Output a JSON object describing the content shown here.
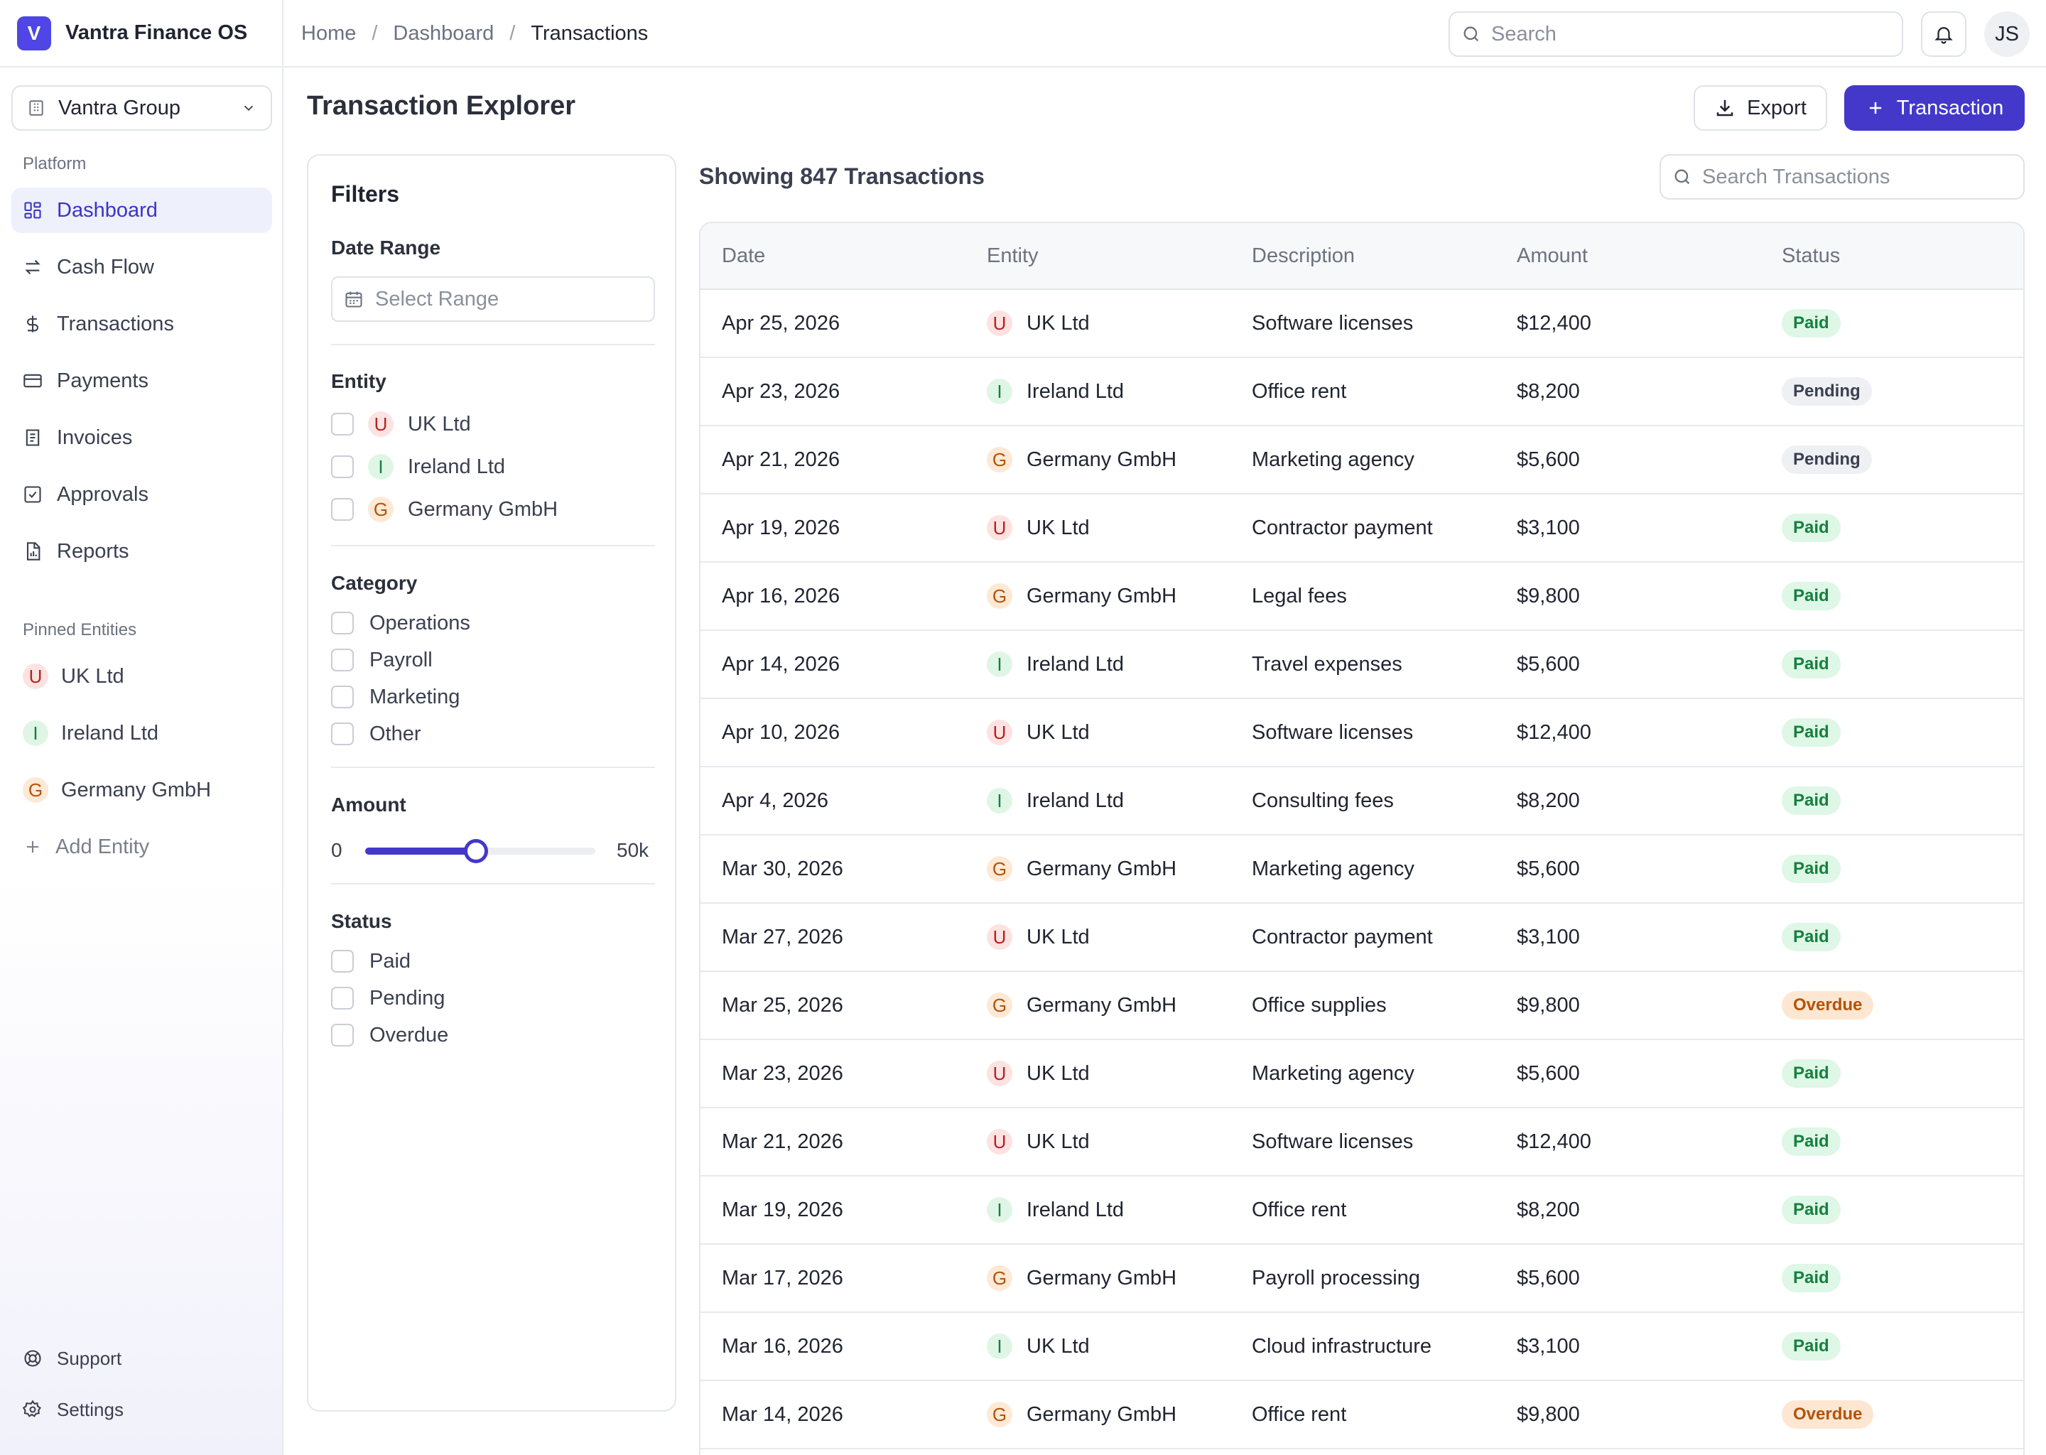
{
  "app": {
    "title": "Vantra Finance OS",
    "logo_letter": "V"
  },
  "org_switcher": {
    "name": "Vantra Group"
  },
  "sidebar": {
    "platform_label": "Platform",
    "items": [
      {
        "label": "Dashboard",
        "icon": "dashboard-icon"
      },
      {
        "label": "Cash Flow",
        "icon": "arrows-swap-icon"
      },
      {
        "label": "Transactions",
        "icon": "dollar-icon"
      },
      {
        "label": "Payments",
        "icon": "credit-card-icon"
      },
      {
        "label": "Invoices",
        "icon": "invoice-icon"
      },
      {
        "label": "Approvals",
        "icon": "check-square-icon"
      },
      {
        "label": "Reports",
        "icon": "report-icon"
      }
    ],
    "pinned_label": "Pinned Entities",
    "pinned": [
      {
        "initial": "U",
        "label": "UK Ltd"
      },
      {
        "initial": "I",
        "label": "Ireland Ltd"
      },
      {
        "initial": "G",
        "label": "Germany GmbH"
      }
    ],
    "add_entity": "Add Entity",
    "support": "Support",
    "settings": "Settings"
  },
  "breadcrumb": {
    "items": [
      "Home",
      "Dashboard",
      "Transactions"
    ],
    "separator": "/"
  },
  "search": {
    "placeholder": "Search"
  },
  "user": {
    "initials": "JS"
  },
  "page": {
    "title": "Transaction Explorer",
    "export_label": "Export",
    "new_label": "Transaction"
  },
  "filters": {
    "title": "Filters",
    "date_range": {
      "label": "Date Range",
      "placeholder": "Select Range"
    },
    "entity": {
      "label": "Entity",
      "options": [
        {
          "initial": "U",
          "label": "UK Ltd"
        },
        {
          "initial": "I",
          "label": "Ireland Ltd"
        },
        {
          "initial": "G",
          "label": "Germany GmbH"
        }
      ]
    },
    "category": {
      "label": "Category",
      "options": [
        "Operations",
        "Payroll",
        "Marketing",
        "Other"
      ]
    },
    "amount": {
      "label": "Amount",
      "min": "0",
      "max": "50k",
      "level": 0.48
    },
    "status": {
      "label": "Status",
      "options": [
        "Paid",
        "Pending",
        "Overdue"
      ]
    }
  },
  "table": {
    "showing": "Showing 847 Transactions",
    "search_placeholder": "Search Transactions",
    "columns": [
      "Date",
      "Entity",
      "Description",
      "Amount",
      "Status"
    ],
    "rows": [
      {
        "date": "Apr 25, 2026",
        "initial": "U",
        "entity": "UK Ltd",
        "description": "Software licenses",
        "amount": "$12,400",
        "status": "Paid"
      },
      {
        "date": "Apr 23, 2026",
        "initial": "I",
        "entity": "Ireland Ltd",
        "description": "Office rent",
        "amount": "$8,200",
        "status": "Pending"
      },
      {
        "date": "Apr 21, 2026",
        "initial": "G",
        "entity": "Germany GmbH",
        "description": "Marketing agency",
        "amount": "$5,600",
        "status": "Pending"
      },
      {
        "date": "Apr 19, 2026",
        "initial": "U",
        "entity": "UK Ltd",
        "description": "Contractor payment",
        "amount": "$3,100",
        "status": "Paid"
      },
      {
        "date": "Apr 16, 2026",
        "initial": "G",
        "entity": "Germany GmbH",
        "description": "Legal fees",
        "amount": "$9,800",
        "status": "Paid"
      },
      {
        "date": "Apr 14, 2026",
        "initial": "I",
        "entity": "Ireland Ltd",
        "description": "Travel expenses",
        "amount": "$5,600",
        "status": "Paid"
      },
      {
        "date": "Apr 10, 2026",
        "initial": "U",
        "entity": "UK Ltd",
        "description": "Software licenses",
        "amount": "$12,400",
        "status": "Paid"
      },
      {
        "date": "Apr 4, 2026",
        "initial": "I",
        "entity": "Ireland Ltd",
        "description": "Consulting fees",
        "amount": "$8,200",
        "status": "Paid"
      },
      {
        "date": "Mar 30, 2026",
        "initial": "G",
        "entity": "Germany GmbH",
        "description": "Marketing agency",
        "amount": "$5,600",
        "status": "Paid"
      },
      {
        "date": "Mar 27, 2026",
        "initial": "U",
        "entity": "UK Ltd",
        "description": "Contractor payment",
        "amount": "$3,100",
        "status": "Paid"
      },
      {
        "date": "Mar 25, 2026",
        "initial": "G",
        "entity": "Germany GmbH",
        "description": "Office supplies",
        "amount": "$9,800",
        "status": "Overdue"
      },
      {
        "date": "Mar 23, 2026",
        "initial": "U",
        "entity": "UK Ltd",
        "description": "Marketing agency",
        "amount": "$5,600",
        "status": "Paid"
      },
      {
        "date": "Mar 21, 2026",
        "initial": "U",
        "entity": "UK Ltd",
        "description": "Software licenses",
        "amount": "$12,400",
        "status": "Paid"
      },
      {
        "date": "Mar 19, 2026",
        "initial": "I",
        "entity": "Ireland Ltd",
        "description": "Office rent",
        "amount": "$8,200",
        "status": "Paid"
      },
      {
        "date": "Mar 17, 2026",
        "initial": "G",
        "entity": "Germany GmbH",
        "description": "Payroll processing",
        "amount": "$5,600",
        "status": "Paid"
      },
      {
        "date": "Mar 16, 2026",
        "initial": "I",
        "entity": "UK Ltd",
        "description": "Cloud infrastructure",
        "amount": "$3,100",
        "status": "Paid"
      },
      {
        "date": "Mar 14, 2026",
        "initial": "G",
        "entity": "Germany GmbH",
        "description": "Office rent",
        "amount": "$9,800",
        "status": "Overdue"
      }
    ]
  },
  "colors": {
    "accent": "#4338ca",
    "paid": "#15803d",
    "overdue": "#b45309"
  }
}
